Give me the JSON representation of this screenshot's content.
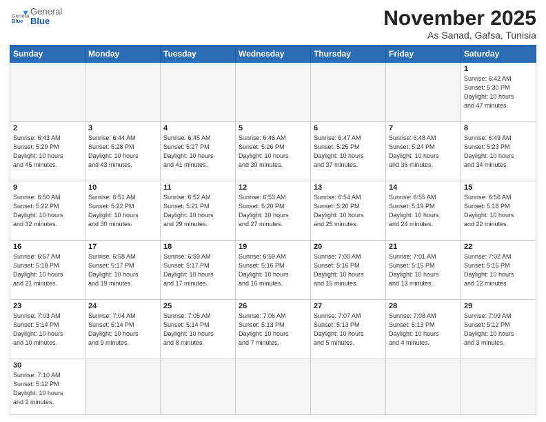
{
  "header": {
    "logo_general": "General",
    "logo_blue": "Blue",
    "month_title": "November 2025",
    "location": "As Sanad, Gafsa, Tunisia"
  },
  "weekdays": [
    "Sunday",
    "Monday",
    "Tuesday",
    "Wednesday",
    "Thursday",
    "Friday",
    "Saturday"
  ],
  "weeks": [
    [
      {
        "day": "",
        "info": ""
      },
      {
        "day": "",
        "info": ""
      },
      {
        "day": "",
        "info": ""
      },
      {
        "day": "",
        "info": ""
      },
      {
        "day": "",
        "info": ""
      },
      {
        "day": "",
        "info": ""
      },
      {
        "day": "1",
        "info": "Sunrise: 6:42 AM\nSunset: 5:30 PM\nDaylight: 10 hours\nand 47 minutes."
      }
    ],
    [
      {
        "day": "2",
        "info": "Sunrise: 6:43 AM\nSunset: 5:29 PM\nDaylight: 10 hours\nand 45 minutes."
      },
      {
        "day": "3",
        "info": "Sunrise: 6:44 AM\nSunset: 5:28 PM\nDaylight: 10 hours\nand 43 minutes."
      },
      {
        "day": "4",
        "info": "Sunrise: 6:45 AM\nSunset: 5:27 PM\nDaylight: 10 hours\nand 41 minutes."
      },
      {
        "day": "5",
        "info": "Sunrise: 6:46 AM\nSunset: 5:26 PM\nDaylight: 10 hours\nand 39 minutes."
      },
      {
        "day": "6",
        "info": "Sunrise: 6:47 AM\nSunset: 5:25 PM\nDaylight: 10 hours\nand 37 minutes."
      },
      {
        "day": "7",
        "info": "Sunrise: 6:48 AM\nSunset: 5:24 PM\nDaylight: 10 hours\nand 36 minutes."
      },
      {
        "day": "8",
        "info": "Sunrise: 6:49 AM\nSunset: 5:23 PM\nDaylight: 10 hours\nand 34 minutes."
      }
    ],
    [
      {
        "day": "9",
        "info": "Sunrise: 6:50 AM\nSunset: 5:22 PM\nDaylight: 10 hours\nand 32 minutes."
      },
      {
        "day": "10",
        "info": "Sunrise: 6:51 AM\nSunset: 5:22 PM\nDaylight: 10 hours\nand 30 minutes."
      },
      {
        "day": "11",
        "info": "Sunrise: 6:52 AM\nSunset: 5:21 PM\nDaylight: 10 hours\nand 29 minutes."
      },
      {
        "day": "12",
        "info": "Sunrise: 6:53 AM\nSunset: 5:20 PM\nDaylight: 10 hours\nand 27 minutes."
      },
      {
        "day": "13",
        "info": "Sunrise: 6:54 AM\nSunset: 5:20 PM\nDaylight: 10 hours\nand 25 minutes."
      },
      {
        "day": "14",
        "info": "Sunrise: 6:55 AM\nSunset: 5:19 PM\nDaylight: 10 hours\nand 24 minutes."
      },
      {
        "day": "15",
        "info": "Sunrise: 6:56 AM\nSunset: 5:18 PM\nDaylight: 10 hours\nand 22 minutes."
      }
    ],
    [
      {
        "day": "16",
        "info": "Sunrise: 6:57 AM\nSunset: 5:18 PM\nDaylight: 10 hours\nand 21 minutes."
      },
      {
        "day": "17",
        "info": "Sunrise: 6:58 AM\nSunset: 5:17 PM\nDaylight: 10 hours\nand 19 minutes."
      },
      {
        "day": "18",
        "info": "Sunrise: 6:59 AM\nSunset: 5:17 PM\nDaylight: 10 hours\nand 17 minutes."
      },
      {
        "day": "19",
        "info": "Sunrise: 6:59 AM\nSunset: 5:16 PM\nDaylight: 10 hours\nand 16 minutes."
      },
      {
        "day": "20",
        "info": "Sunrise: 7:00 AM\nSunset: 5:16 PM\nDaylight: 10 hours\nand 15 minutes."
      },
      {
        "day": "21",
        "info": "Sunrise: 7:01 AM\nSunset: 5:15 PM\nDaylight: 10 hours\nand 13 minutes."
      },
      {
        "day": "22",
        "info": "Sunrise: 7:02 AM\nSunset: 5:15 PM\nDaylight: 10 hours\nand 12 minutes."
      }
    ],
    [
      {
        "day": "23",
        "info": "Sunrise: 7:03 AM\nSunset: 5:14 PM\nDaylight: 10 hours\nand 10 minutes."
      },
      {
        "day": "24",
        "info": "Sunrise: 7:04 AM\nSunset: 5:14 PM\nDaylight: 10 hours\nand 9 minutes."
      },
      {
        "day": "25",
        "info": "Sunrise: 7:05 AM\nSunset: 5:14 PM\nDaylight: 10 hours\nand 8 minutes."
      },
      {
        "day": "26",
        "info": "Sunrise: 7:06 AM\nSunset: 5:13 PM\nDaylight: 10 hours\nand 7 minutes."
      },
      {
        "day": "27",
        "info": "Sunrise: 7:07 AM\nSunset: 5:13 PM\nDaylight: 10 hours\nand 5 minutes."
      },
      {
        "day": "28",
        "info": "Sunrise: 7:08 AM\nSunset: 5:13 PM\nDaylight: 10 hours\nand 4 minutes."
      },
      {
        "day": "29",
        "info": "Sunrise: 7:09 AM\nSunset: 5:12 PM\nDaylight: 10 hours\nand 3 minutes."
      }
    ],
    [
      {
        "day": "30",
        "info": "Sunrise: 7:10 AM\nSunset: 5:12 PM\nDaylight: 10 hours\nand 2 minutes."
      },
      {
        "day": "",
        "info": ""
      },
      {
        "day": "",
        "info": ""
      },
      {
        "day": "",
        "info": ""
      },
      {
        "day": "",
        "info": ""
      },
      {
        "day": "",
        "info": ""
      },
      {
        "day": "",
        "info": ""
      }
    ]
  ]
}
